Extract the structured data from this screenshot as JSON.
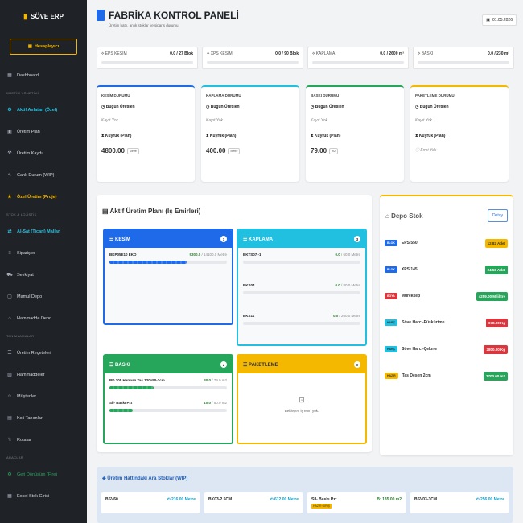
{
  "app": {
    "name": "SÖVE ERP",
    "account": "Hesaplayıcı"
  },
  "sidebar": {
    "items": [
      {
        "label": "Dashboard",
        "icon": "dashboard-icon"
      },
      {
        "section": "ÜRETİM YÖNETİMİ"
      },
      {
        "label": "Aktif Aslatan (Özel)",
        "icon": "gear-icon",
        "accent": "cyan"
      },
      {
        "label": "Üretim Plan",
        "icon": "calendar-icon"
      },
      {
        "label": "Üretim Kaydı",
        "icon": "hammer-icon"
      },
      {
        "label": "Canlı Durum (WIP)",
        "icon": "pulse-icon"
      },
      {
        "label": "Özel Üretim (Proje)",
        "icon": "star-icon",
        "accent": "gold"
      },
      {
        "section": "STOK & LOJİSTİK"
      },
      {
        "label": "Al-Sat (Ticari) Mallar",
        "icon": "cart-icon",
        "accent": "cyan"
      },
      {
        "label": "Siparişler",
        "icon": "order-icon"
      },
      {
        "label": "Sevkiyat",
        "icon": "truck-icon"
      },
      {
        "label": "Mamul Depo",
        "icon": "box-icon"
      },
      {
        "label": "Hammadde Depo",
        "icon": "warehouse-icon"
      },
      {
        "section": "TANIMLAMALAR"
      },
      {
        "label": "Üretim Reçeteleri",
        "icon": "recipe-icon"
      },
      {
        "label": "Hammaddeler",
        "icon": "material-icon"
      },
      {
        "label": "Müşteriler",
        "icon": "users-icon"
      },
      {
        "label": "Koli Tanımları",
        "icon": "package-icon"
      },
      {
        "label": "Rotalar",
        "icon": "route-icon"
      },
      {
        "section": "ARAÇLAR"
      },
      {
        "label": "Geri Dönüşüm (Fire)",
        "icon": "recycle-icon",
        "accent": "green"
      },
      {
        "label": "Excel Stok Girişi",
        "icon": "excel-icon"
      }
    ]
  },
  "header": {
    "title": "FABRİKA KONTROL PANELİ",
    "subtitle": "Üretim hattı, anlık stoklar ve sipariş durumu.",
    "date": "01.05.2026"
  },
  "stats": [
    {
      "label": "EPS KESİM",
      "value": "0.0 / 27 Blok"
    },
    {
      "label": "XPS KESİM",
      "value": "0.0 / 90 Blok"
    },
    {
      "label": "KAPLAMA",
      "value": "0.0 / 2600 m²"
    },
    {
      "label": "BASKI",
      "value": "0.0 / 230 m²"
    }
  ],
  "process": [
    {
      "title": "KESİM DURUMU",
      "today": "Bugün Üretilen",
      "note": "Kayıt Yok",
      "queue": "Kuyruk (Plan)",
      "value": "4800.00",
      "unit": "Metre",
      "color": "#1e6ae8"
    },
    {
      "title": "KAPLAMA DURUMU",
      "today": "Bugün Üretilen",
      "note": "Kayıt Yok",
      "queue": "Kuyruk (Plan)",
      "value": "400.00",
      "unit": "Metre",
      "color": "#22c0e0"
    },
    {
      "title": "BASKI DURUMU",
      "today": "Bugün Üretilen",
      "note": "Kayıt Yok",
      "queue": "Kuyruk (Plan)",
      "value": "79.00",
      "unit": "m2",
      "color": "#26a65b"
    },
    {
      "title": "PAKETLEME DURUMU",
      "today": "Bugün Üretilen",
      "note": "Kayıt Yok",
      "queue": "Kuyruk (Plan)",
      "value": "",
      "unit": "",
      "empty": "Emri Yok",
      "color": "#f5b800"
    }
  ],
  "plan": {
    "title": "Aktif Üretim Planı (İş Emirleri)",
    "stages": [
      {
        "name": "KESİM",
        "count": "1",
        "color": "#1e6ae8",
        "jobs": [
          {
            "name": "BKP05E10 EKO",
            "done": "9300.0",
            "total": "/ 14100.0 Metre",
            "pct": 0.66
          }
        ]
      },
      {
        "name": "KAPLAMA",
        "count": "3",
        "color": "#22c0e0",
        "jobs": [
          {
            "name": "BKTS07 -1",
            "done": "0.0",
            "total": "/ 60.0 Metre",
            "pct": 0
          },
          {
            "name": "BKS04",
            "done": "0.0",
            "total": "/ 80.0 Metre",
            "pct": 0
          },
          {
            "name": "BKS11",
            "done": "0.0",
            "total": "/ 260.0 Metre",
            "pct": 0
          }
        ]
      },
      {
        "name": "BASKI",
        "count": "2",
        "color": "#26a65b",
        "jobs": [
          {
            "name": "BD 205 Harman Taş 120x50-2cm",
            "done": "30.0",
            "total": "/ 79.0 m2",
            "pct": 0.38
          },
          {
            "name": "Sil- Baskı Pzt",
            "done": "10.0",
            "total": "/ 50.0 m2",
            "pct": 0.2
          }
        ]
      },
      {
        "name": "PAKETLEME",
        "count": "0",
        "color": "#f5b800",
        "jobs": [],
        "empty": "Bekleyen iş emri yok."
      }
    ]
  },
  "depo": {
    "title": "Depo Stok",
    "button": "Detay",
    "items": [
      {
        "tag": "BLOK",
        "tagColor": "#1e6ae8",
        "name": "EPS 550",
        "qty": "12.82 Adet",
        "qtyColor": "#f5b800"
      },
      {
        "tag": "BLOK",
        "tagColor": "#1e6ae8",
        "name": "XPS 145",
        "qty": "24.58 Adet",
        "qtyColor": "#26a65b"
      },
      {
        "tag": "BOYA",
        "tagColor": "#d9363e",
        "name": "Mürekkep",
        "qty": "4259.00 Mililitre",
        "qtyColor": "#26a65b"
      },
      {
        "tag": "HARÇ",
        "tagColor": "#22c0e0",
        "name": "Söve Harcı-Püskürtme",
        "qty": "678.00 Kg",
        "qtyColor": "#d9363e"
      },
      {
        "tag": "HARÇ",
        "tagColor": "#22c0e0",
        "name": "Söve Harcı-Çekme",
        "qty": "2800.00 Kg",
        "qtyColor": "#d9363e"
      },
      {
        "tag": "HAZIR",
        "tagColor": "#f5b800",
        "name": "Taş Desen 2cm",
        "qty": "3700.00 m2",
        "qtyColor": "#26a65b"
      }
    ]
  },
  "wip": {
    "title": "Üretim Hattındaki Ara Stoklar (WIP)",
    "items": [
      {
        "name": "BSV60",
        "value": "216.00 Metre"
      },
      {
        "name": "BK03-2.5CM",
        "value": "612.00 Metre"
      },
      {
        "name": "Sil- Baskı Pzt",
        "badge": "HAZIR GİRİŞ",
        "value": "B: 135.00 m2"
      },
      {
        "name": "BSV03-3CM",
        "value": "256.00 Metre"
      }
    ]
  }
}
